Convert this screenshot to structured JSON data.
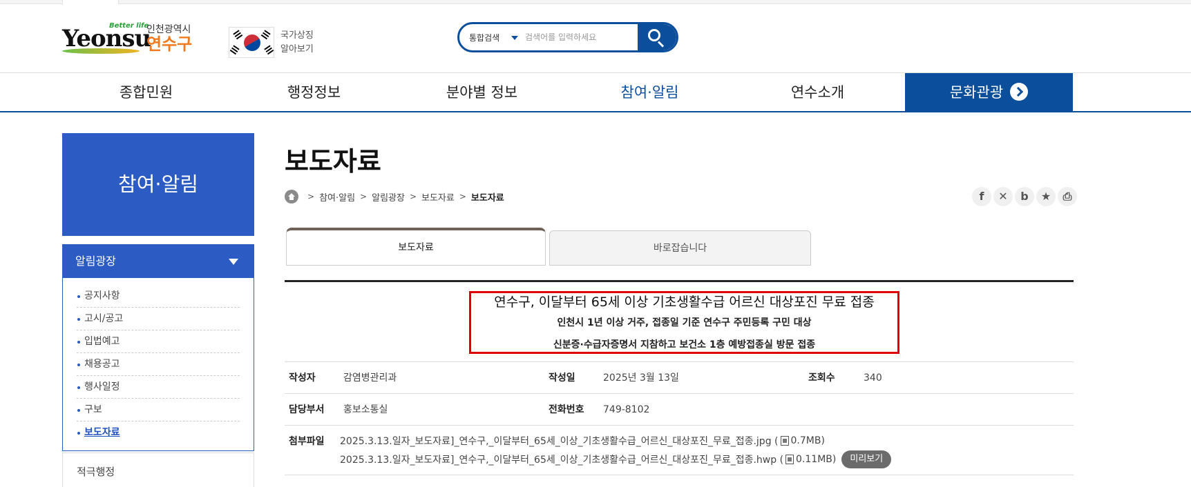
{
  "header": {
    "logo_mark": "Yeonsu",
    "logo_slogan": "Better life",
    "logo_city": "인천광역시",
    "logo_gu": "연수구",
    "flag_label": "국가상징 알아보기",
    "search": {
      "scope": "통합검색",
      "placeholder": "검색어를 입력하세요"
    }
  },
  "gnb": [
    {
      "label": "종합민원"
    },
    {
      "label": "행정정보"
    },
    {
      "label": "분야별 정보"
    },
    {
      "label": "참여·알림"
    },
    {
      "label": "연수소개"
    },
    {
      "label": "문화관광"
    }
  ],
  "lnb": {
    "title": "참여·알림",
    "group": "알림광장",
    "items": [
      {
        "label": "공지사항"
      },
      {
        "label": "고시/공고"
      },
      {
        "label": "입법예고"
      },
      {
        "label": "채용공고"
      },
      {
        "label": "행사일정"
      },
      {
        "label": "구보"
      },
      {
        "label": "보도자료"
      }
    ],
    "next_group": "적극행정"
  },
  "content": {
    "title": "보도자료",
    "breadcrumb": [
      "참여·알림",
      "알림광장",
      "보도자료",
      "보도자료"
    ],
    "share_icons": [
      "facebook-icon",
      "x-icon",
      "blog-icon",
      "star-icon",
      "print-icon"
    ],
    "tabs": [
      {
        "label": "보도자료"
      },
      {
        "label": "바로잡습니다"
      }
    ],
    "article": {
      "headline": "연수구, 이달부터 65세 이상 기초생활수급 어르신 대상포진 무료 접종",
      "sub1": "인천시 1년 이상 거주, 접종일 기준 연수구 주민등록 구민 대상",
      "sub2": "신분증·수급자증명서 지참하고 보건소 1층 예방접종실 방문 접종"
    },
    "info": {
      "author_label": "작성자",
      "author": "감염병관리과",
      "date_label": "작성일",
      "date": "2025년 3월 13일",
      "views_label": "조회수",
      "views": "340",
      "dept_label": "담당부서",
      "dept": "홍보소통실",
      "phone_label": "전화번호",
      "phone": "749-8102",
      "files_label": "첨부파일",
      "files": [
        {
          "name": "2025.3.13.일자_보도자료]_연수구,_이달부터_65세_이상_기초생활수급_어르신_대상포진_무료_접종.jpg (",
          "size": "0.7MB)"
        },
        {
          "name": "2025.3.13.일자_보도자료]_연수구,_이달부터_65세_이상_기초생활수급_어르신_대상포진_무료_접종.hwp (",
          "size": "0.11MB)"
        }
      ],
      "preview_label": "미리보기"
    }
  },
  "colors": {
    "brand_blue": "#0b4e9c",
    "lnb_blue": "#2b5bc3",
    "highlight_red": "#e00000",
    "logo_orange": "#f07a1f"
  }
}
